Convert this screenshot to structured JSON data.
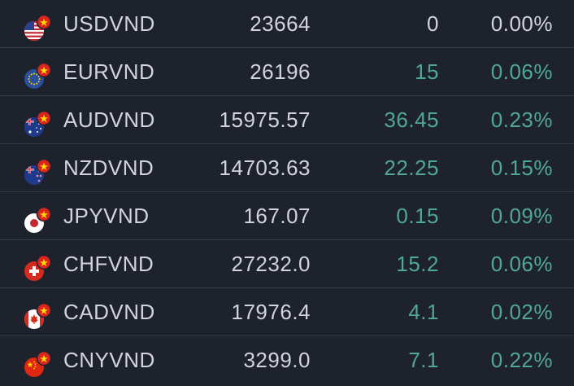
{
  "colors": {
    "background": "#1e222d",
    "divider": "#363a45",
    "text": "#d1d4dc",
    "positive": "#4fa894"
  },
  "rows": [
    {
      "symbol": "USDVND",
      "price": "23664",
      "change": "0",
      "percent": "0.00%",
      "direction": "neutral",
      "flag": "us-flag-icon"
    },
    {
      "symbol": "EURVND",
      "price": "26196",
      "change": "15",
      "percent": "0.06%",
      "direction": "up",
      "flag": "eu-flag-icon"
    },
    {
      "symbol": "AUDVND",
      "price": "15975.57",
      "change": "36.45",
      "percent": "0.23%",
      "direction": "up",
      "flag": "au-flag-icon"
    },
    {
      "symbol": "NZDVND",
      "price": "14703.63",
      "change": "22.25",
      "percent": "0.15%",
      "direction": "up",
      "flag": "nz-flag-icon"
    },
    {
      "symbol": "JPYVND",
      "price": "167.07",
      "change": "0.15",
      "percent": "0.09%",
      "direction": "up",
      "flag": "jp-flag-icon"
    },
    {
      "symbol": "CHFVND",
      "price": "27232.0",
      "change": "15.2",
      "percent": "0.06%",
      "direction": "up",
      "flag": "ch-flag-icon"
    },
    {
      "symbol": "CADVND",
      "price": "17976.4",
      "change": "4.1",
      "percent": "0.02%",
      "direction": "up",
      "flag": "ca-flag-icon"
    },
    {
      "symbol": "CNYVND",
      "price": "3299.0",
      "change": "7.1",
      "percent": "0.22%",
      "direction": "up",
      "flag": "cn-flag-icon"
    }
  ]
}
